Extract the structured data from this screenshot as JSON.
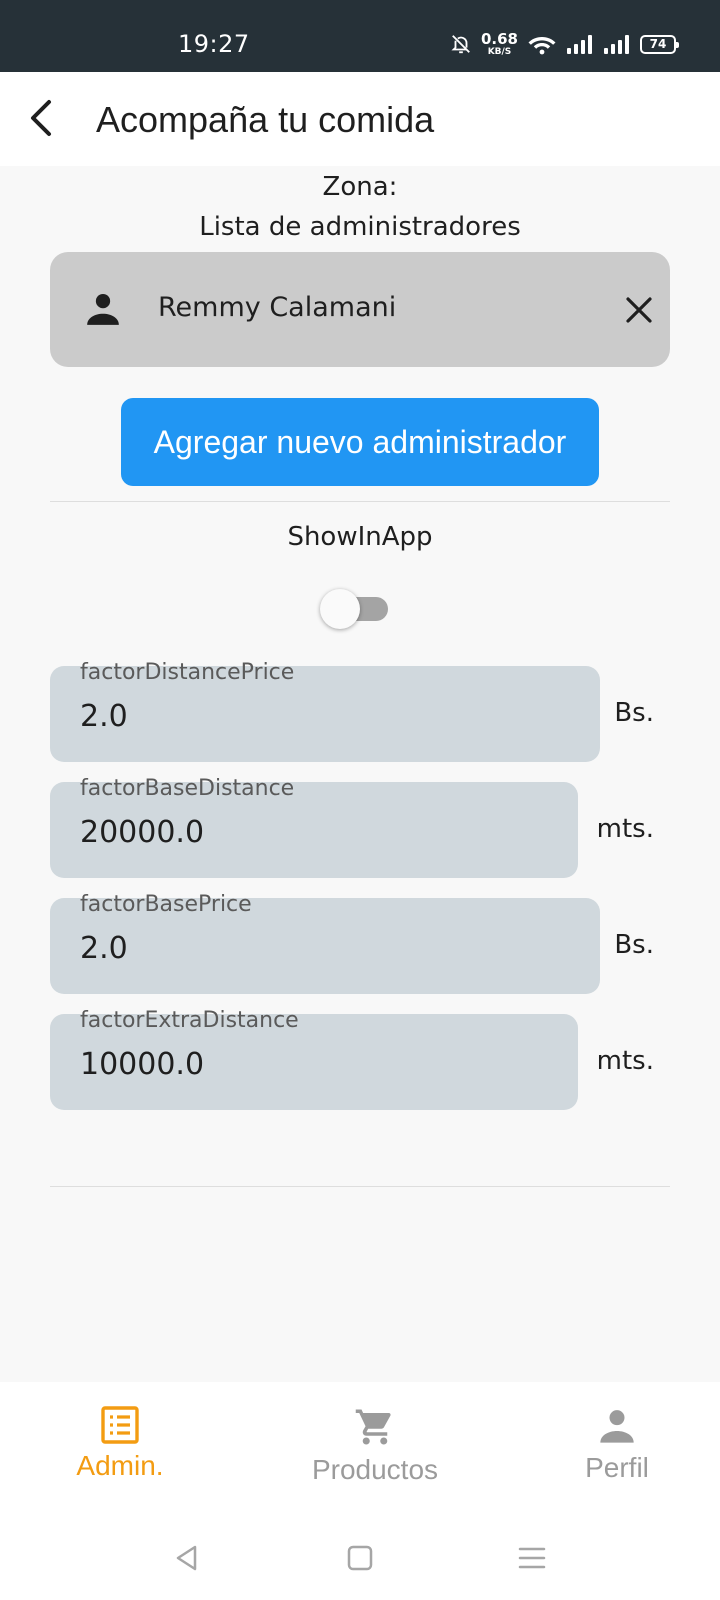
{
  "status_bar": {
    "time": "19:27",
    "net_speed_value": "0.68",
    "net_speed_unit": "KB/S",
    "battery": "74",
    "icons": [
      "bell-off-icon",
      "wifi-icon",
      "signal-icon",
      "signal-icon",
      "battery-icon"
    ]
  },
  "app_bar": {
    "title": "Acompaña tu comida",
    "back_icon": "back-arrow-icon"
  },
  "zone_label": "Zona:",
  "admins_heading": "Lista de administradores",
  "admins": [
    {
      "name": "Remmy Calamani",
      "icon": "person-icon",
      "remove_icon": "close-icon"
    }
  ],
  "add_admin_button": "Agregar nuevo administrador",
  "show_in_app": {
    "label": "ShowInApp",
    "enabled": false
  },
  "fields": [
    {
      "label": "factorDistancePrice",
      "value": "2.0",
      "unit": "Bs."
    },
    {
      "label": "factorBaseDistance",
      "value": "20000.0",
      "unit": "mts."
    },
    {
      "label": "factorBasePrice",
      "value": "2.0",
      "unit": "Bs."
    },
    {
      "label": "factorExtraDistance",
      "value": "10000.0",
      "unit": "mts."
    }
  ],
  "bottom_nav": [
    {
      "label": "Admin.",
      "icon": "list-icon",
      "active": true
    },
    {
      "label": "Productos",
      "icon": "cart-icon",
      "active": false
    },
    {
      "label": "Perfil",
      "icon": "person-icon",
      "active": false
    }
  ],
  "colors": {
    "primary_button": "#2196f3",
    "active_nav": "#f39c12",
    "inactive_nav": "#9b9b9b",
    "status_bar": "#263138",
    "field_background": "#d0d8dd",
    "chip_background": "#cbcbcb"
  }
}
